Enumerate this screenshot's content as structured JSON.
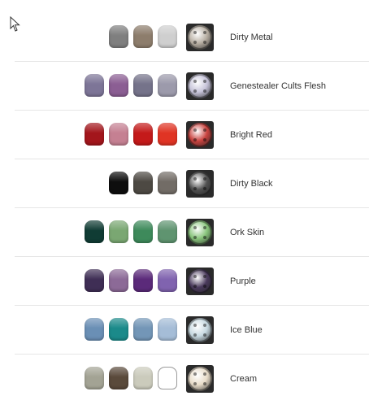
{
  "paints": [
    {
      "name": "Dirty Metal",
      "colors": [
        "#7f7f7f",
        "#8d7d6c",
        "#cfcfcf"
      ],
      "outline_last": false,
      "mini_color": "#b7aea2"
    },
    {
      "name": "Genestealer Cults Flesh",
      "colors": [
        "#7d7597",
        "#8b5e93",
        "#75738a",
        "#9c9aab"
      ],
      "outline_last": false,
      "mini_color": "#c6c3d9"
    },
    {
      "name": "Bright Red",
      "colors": [
        "#a3161c",
        "#c58092",
        "#c41a1a",
        "#e03424"
      ],
      "outline_last": false,
      "mini_color": "#c9433f"
    },
    {
      "name": "Dirty Black",
      "colors": [
        "#0e0e0e",
        "#4d4943",
        "#726c66"
      ],
      "outline_last": false,
      "mini_color": "#505050"
    },
    {
      "name": "Ork Skin",
      "colors": [
        "#103c34",
        "#7aa772",
        "#3e8a5b",
        "#5f9470"
      ],
      "outline_last": false,
      "mini_color": "#89c57c"
    },
    {
      "name": "Purple",
      "colors": [
        "#3f2e55",
        "#8c6a97",
        "#5b2a7a",
        "#8063af"
      ],
      "outline_last": false,
      "mini_color": "#4a3a5c"
    },
    {
      "name": "Ice Blue",
      "colors": [
        "#6a8fb5",
        "#1b8a8a",
        "#7396b7",
        "#a5bdd7"
      ],
      "outline_last": false,
      "mini_color": "#c7d9e1"
    },
    {
      "name": "Cream",
      "colors": [
        "#a3a394",
        "#5a4a3b",
        "#cbcbbc",
        "#ffffff"
      ],
      "outline_last": true,
      "mini_color": "#e8dcc9"
    }
  ]
}
